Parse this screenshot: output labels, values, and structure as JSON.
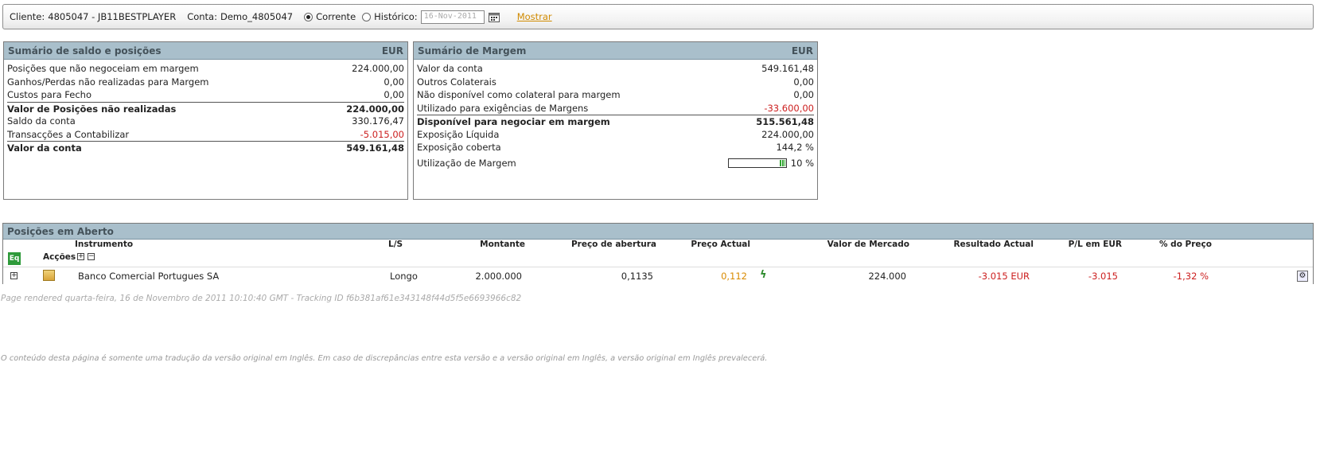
{
  "header": {
    "client_label": "Cliente:",
    "client_value": "4805047 - JB11BESTPLAYER",
    "account_label": "Conta:",
    "account_value": "Demo_4805047",
    "radio_current": "Corrente",
    "radio_history": "Histórico:",
    "date_value": "16-Nov-2011",
    "show_link": "Mostrar"
  },
  "balance": {
    "title": "Sumário de saldo e posições",
    "currency": "EUR",
    "rows": [
      {
        "label": "Posições que não negoceiam em margem",
        "value": "224.000,00"
      },
      {
        "label": "Ganhos/Perdas não realizadas para Margem",
        "value": "0,00"
      },
      {
        "label": "Custos para Fecho",
        "value": "0,00"
      },
      {
        "label": "Valor de Posições não realizadas",
        "value": "224.000,00"
      },
      {
        "label": "Saldo da conta",
        "value": "330.176,47"
      },
      {
        "label": "Transacções a Contabilizar",
        "value": "-5.015,00"
      },
      {
        "label": "Valor da conta",
        "value": "549.161,48"
      }
    ]
  },
  "margin": {
    "title": "Sumário de Margem",
    "currency": "EUR",
    "rows": [
      {
        "label": "Valor da conta",
        "value": "549.161,48"
      },
      {
        "label": "Outros Colaterais",
        "value": "0,00"
      },
      {
        "label": "Não disponível como colateral para margem",
        "value": "0,00"
      },
      {
        "label": "Utilizado para exigências de Margens",
        "value": "-33.600,00"
      },
      {
        "label": "Disponível para negociar em margem",
        "value": "515.561,48"
      },
      {
        "label": "Exposição Líquida",
        "value": "224.000,00"
      },
      {
        "label": "Exposição coberta",
        "value": "144,2 %"
      },
      {
        "label": "Utilização de Margem",
        "value": "10 %"
      }
    ],
    "utilization_fraction": 0.1
  },
  "positions": {
    "title": "Posições em Aberto",
    "columns": {
      "instrument": "Instrumento",
      "ls": "L/S",
      "amount": "Montante",
      "open_price": "Preço de abertura",
      "current_price": "Preço Actual",
      "market_value": "Valor de Mercado",
      "result": "Resultado Actual",
      "pl_eur": "P/L em EUR",
      "pct_price": "% do Preço"
    },
    "eq_icon_text": "Eq",
    "actions_label": "Acções",
    "rows": [
      {
        "instrument": "Banco Comercial Portugues SA",
        "ls": "Longo",
        "amount": "2.000.000",
        "open_price": "0,1135",
        "current_price": "0,112",
        "market_value": "224.000",
        "result": "-3.015 EUR",
        "pl_eur": "-3.015",
        "pct_price": "-1,32 %"
      }
    ]
  },
  "footer": {
    "rendered": "Page rendered quarta-feira, 16 de Novembro de 2011 10:10:40 GMT - Tracking ID f6b381af61e343148f44d5f5e6693966c82",
    "disclaimer": "O conteúdo desta página é somente uma tradução da versão original em Inglês. Em caso de discrepâncias entre esta versão e a versão original em Inglês, a versão original em Inglês prevalecerá."
  },
  "colors": {
    "header_bg": "#a9bfcb",
    "negative": "#cc1f1f",
    "link": "#d08a00",
    "gauge": "#2fa52f"
  }
}
